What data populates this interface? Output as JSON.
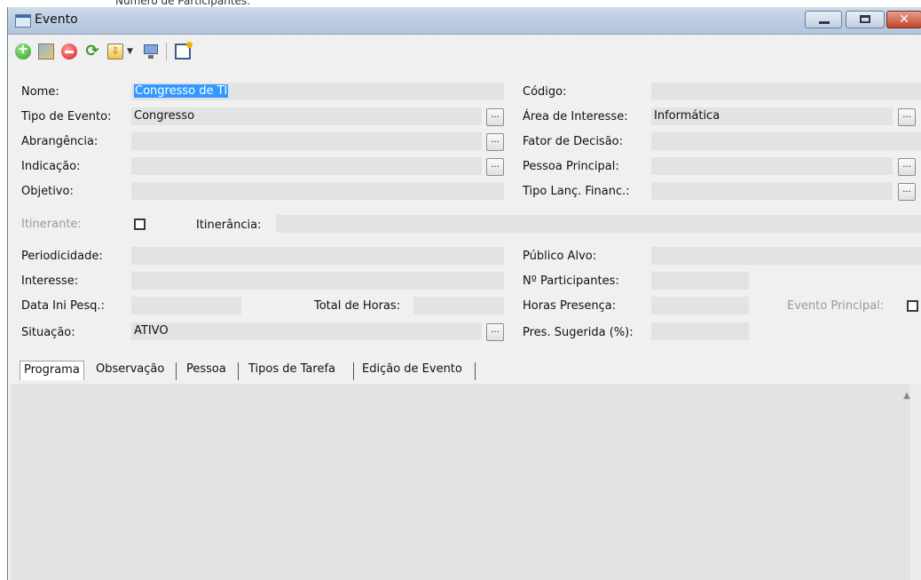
{
  "background_fragment": "Número de Participantes:",
  "window": {
    "title": "Evento",
    "close_glyph": "✕"
  },
  "toolbar": {
    "icons": [
      "add-icon",
      "edit-icon",
      "delete-icon",
      "refresh-icon",
      "import-icon",
      "dropdown-arrow-icon",
      "screen-icon",
      "new-window-icon"
    ],
    "dropdown_glyph": "▼",
    "refresh_glyph": "⟳",
    "import_glyph": "⇩"
  },
  "form": {
    "nome": {
      "label": "Nome:",
      "value": "Congresso de TI"
    },
    "tipo_evento": {
      "label": "Tipo de Evento:",
      "value": "Congresso"
    },
    "abrangencia": {
      "label": "Abrangência:",
      "value": ""
    },
    "indicacao": {
      "label": "Indicação:",
      "value": ""
    },
    "objetivo": {
      "label": "Objetivo:",
      "value": ""
    },
    "itinerante": {
      "label": "Itinerante:",
      "checked": false
    },
    "itinerancia": {
      "label": "Itinerância:",
      "value": ""
    },
    "periodicidade": {
      "label": "Periodicidade:",
      "value": ""
    },
    "interesse": {
      "label": "Interesse:",
      "value": ""
    },
    "data_ini_pesq": {
      "label": "Data Ini Pesq.:",
      "value": ""
    },
    "total_horas": {
      "label": "Total de Horas:",
      "value": ""
    },
    "situacao": {
      "label": "Situação:",
      "value": "ATIVO"
    },
    "codigo": {
      "label": "Código:",
      "value": ""
    },
    "area_interesse": {
      "label": "Área de Interesse:",
      "value": "Informática"
    },
    "fator_decisao": {
      "label": "Fator de Decisão:",
      "value": ""
    },
    "pessoa_principal": {
      "label": "Pessoa Principal:",
      "value": ""
    },
    "tipo_lanc_financ": {
      "label": "Tipo Lanç. Financ.:",
      "value": ""
    },
    "publico_alvo": {
      "label": "Público Alvo:",
      "value": ""
    },
    "n_participantes": {
      "label": "Nº Participantes:",
      "value": ""
    },
    "horas_presenca": {
      "label": "Horas Presença:",
      "value": ""
    },
    "pres_sugerida": {
      "label": "Pres. Sugerida (%):",
      "value": ""
    },
    "evento_principal": {
      "label": "Evento Principal:",
      "checked": false
    },
    "ellipsis": "..."
  },
  "tabs": [
    {
      "label": "Programa",
      "active": true
    },
    {
      "label": "Observação",
      "active": false
    },
    {
      "label": "Pessoa",
      "active": false
    },
    {
      "label": "Tipos de Tarefa",
      "active": false
    },
    {
      "label": "Edição de Evento",
      "active": false
    }
  ],
  "scroll_up_glyph": "▲"
}
